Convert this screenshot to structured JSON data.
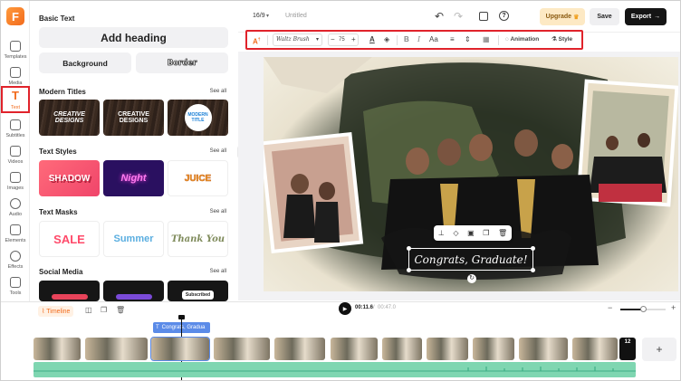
{
  "app": {
    "logo_letter": "F",
    "accent": "#f26b1d",
    "highlight": "#e0232b"
  },
  "sidebar": {
    "items": [
      {
        "label": "Templates",
        "icon": "templates-icon"
      },
      {
        "label": "Media",
        "icon": "media-icon"
      },
      {
        "label": "Text",
        "icon": "text-icon",
        "active": true
      },
      {
        "label": "Subtitles",
        "icon": "subtitles-icon"
      },
      {
        "label": "Videos",
        "icon": "videos-icon"
      },
      {
        "label": "Images",
        "icon": "images-icon"
      },
      {
        "label": "Audio",
        "icon": "audio-icon"
      },
      {
        "label": "Elements",
        "icon": "elements-icon"
      },
      {
        "label": "Effects",
        "icon": "effects-icon"
      },
      {
        "label": "Tools",
        "icon": "tools-icon"
      }
    ]
  },
  "panel": {
    "basic_text": "Basic Text",
    "add_heading": "Add heading",
    "background": "Background",
    "border": "Border",
    "see_all": "See all",
    "modern_titles": {
      "title": "Modern Titles",
      "tiles": [
        "CREATIVE DESIGNS",
        "CREATIVE DESIGNS",
        "MODERN TITLE"
      ]
    },
    "text_styles": {
      "title": "Text Styles",
      "tiles": [
        "SHADOW",
        "Night",
        "JUICE"
      ]
    },
    "text_masks": {
      "title": "Text Masks",
      "tiles": [
        "SALE",
        "Summer",
        "Thank You"
      ]
    },
    "social_media": {
      "title": "Social Media",
      "tiles": [
        "",
        "",
        "Subscribed"
      ]
    }
  },
  "topbar": {
    "ratio": "16/9",
    "project_name": "Untitled",
    "upgrade": "Upgrade",
    "save": "Save",
    "export": "Export"
  },
  "toolbar": {
    "font": "Waltz Brush",
    "size": "75",
    "bold": "B",
    "italic": "I",
    "case": "Aa",
    "animation": "Animation",
    "style": "Style"
  },
  "canvas": {
    "caption": "Congrats, Graduate!"
  },
  "timeline": {
    "label": "Timeline",
    "current_time": "00:11.6",
    "total_time": "00:47.0",
    "text_clip": "Congrats, Gradua",
    "clip_count": "12",
    "playback_progress": 0.5
  }
}
